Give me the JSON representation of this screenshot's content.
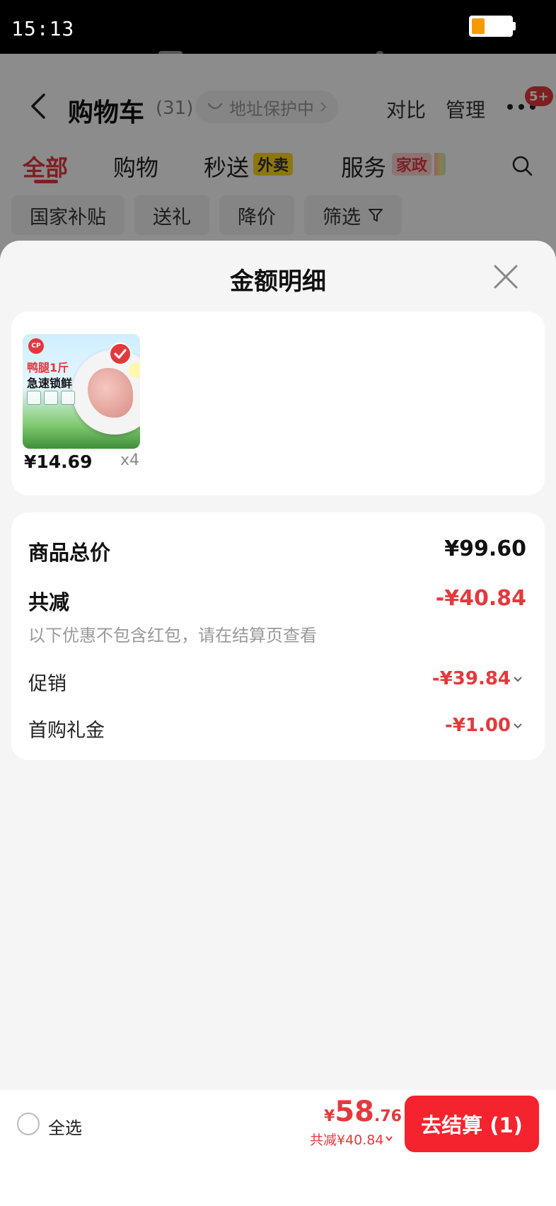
{
  "status_bar": {
    "time": "15:13"
  },
  "header": {
    "title": "购物车",
    "count": "(31)",
    "address_protection": "地址保护中",
    "compare": "对比",
    "manage": "管理",
    "notification_badge": "5+"
  },
  "tabs": [
    {
      "label": "全部"
    },
    {
      "label": "购物"
    },
    {
      "label": "秒送",
      "tag": "外卖"
    },
    {
      "label": "服务",
      "tag": "家政"
    }
  ],
  "filters": [
    "国家补贴",
    "送礼",
    "降价",
    "筛选"
  ],
  "sheet": {
    "title": "金额明细",
    "product": {
      "thumb_line1": "鸭腿1斤",
      "thumb_line2": "急速锁鲜",
      "thumb_logo": "CP",
      "price": "¥14.69",
      "quantity": "x4"
    },
    "details": {
      "subtotal_label": "商品总价",
      "subtotal_value": "¥99.60",
      "discount_label": "共减",
      "discount_value": "-¥40.84",
      "note": "以下优惠不包含红包，请在结算页查看",
      "promo_label": "促销",
      "promo_value": "-¥39.84",
      "gift_label": "首购礼金",
      "gift_value": "-¥1.00"
    }
  },
  "bottom_bar": {
    "select_all": "全选",
    "total_symbol": "¥",
    "total_int": "58",
    "total_dec": ".76",
    "saving": "共减¥40.84",
    "checkout": "去结算 (1)"
  },
  "colors": {
    "accent": "#e4393c",
    "checkout": "#f5232d"
  }
}
